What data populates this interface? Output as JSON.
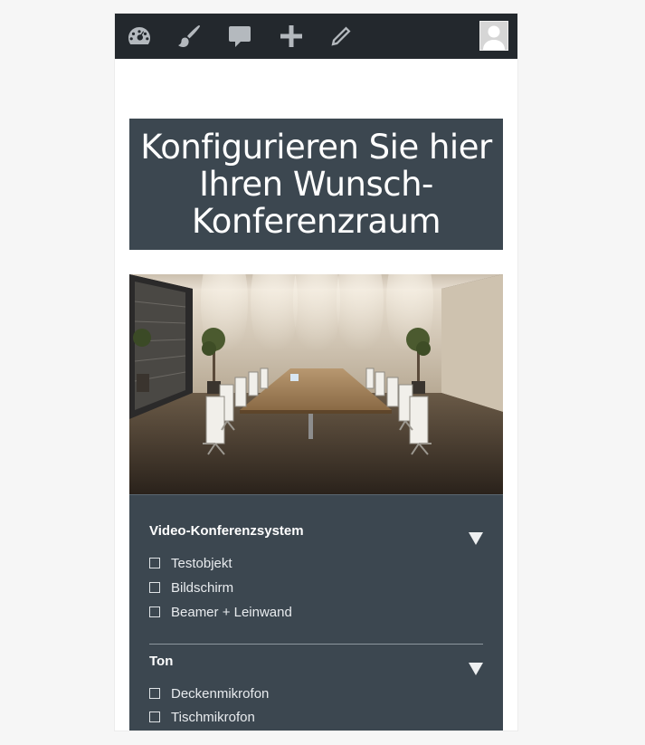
{
  "adminbar": {
    "icons": [
      "dashboard-icon",
      "paintbrush-icon",
      "comment-icon",
      "plus-icon",
      "pencil-icon"
    ],
    "avatar": "user-avatar"
  },
  "hero": {
    "title": "Konfigurieren Sie hier Ihren Wunsch-Konferenzraum"
  },
  "configurator": {
    "sections": [
      {
        "title": "Video-Konferenzsystem",
        "options": [
          "Testobjekt",
          "Bildschirm",
          "Beamer + Leinwand"
        ]
      },
      {
        "title": "Ton",
        "options": [
          "Deckenmikrofon",
          "Tischmikrofon"
        ]
      }
    ]
  },
  "colors": {
    "adminbar": "#23282d",
    "panel": "#3c4750",
    "text": "#ffffff"
  }
}
